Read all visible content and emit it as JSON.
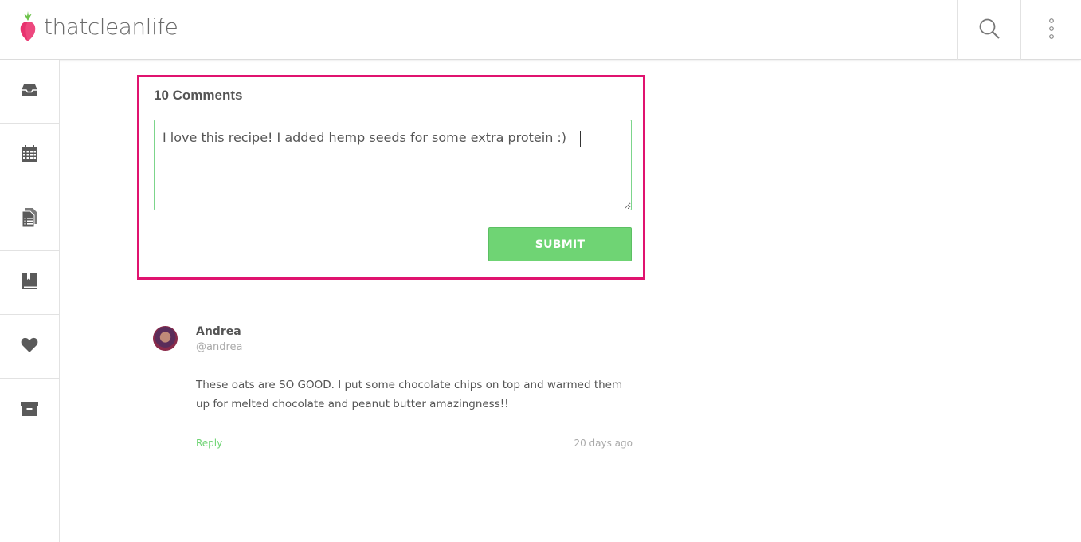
{
  "brand": {
    "name": "thatcleanlife"
  },
  "header": {
    "search_icon": "search-icon",
    "more_icon": "vertical-dots-icon"
  },
  "sidebar": {
    "items": [
      {
        "name": "inbox",
        "icon": "inbox-icon"
      },
      {
        "name": "calendar",
        "icon": "calendar-icon"
      },
      {
        "name": "documents",
        "icon": "document-list-icon"
      },
      {
        "name": "recipe-book",
        "icon": "book-icon"
      },
      {
        "name": "favorites",
        "icon": "heart-icon"
      },
      {
        "name": "archive",
        "icon": "archive-box-icon"
      }
    ]
  },
  "comment_form": {
    "heading": "10 Comments",
    "input_value": "I love this recipe! I added hemp seeds for some extra protein :)",
    "submit_label": "SUBMIT",
    "accent_color": "#e0136f",
    "submit_color": "#6fd474"
  },
  "comments": [
    {
      "author": "Andrea",
      "handle": "@andrea",
      "body": "These oats are SO GOOD. I put some chocolate chips on top and warmed them up for melted chocolate and peanut butter amazingness!!",
      "reply_label": "Reply",
      "time": "20 days ago"
    }
  ]
}
